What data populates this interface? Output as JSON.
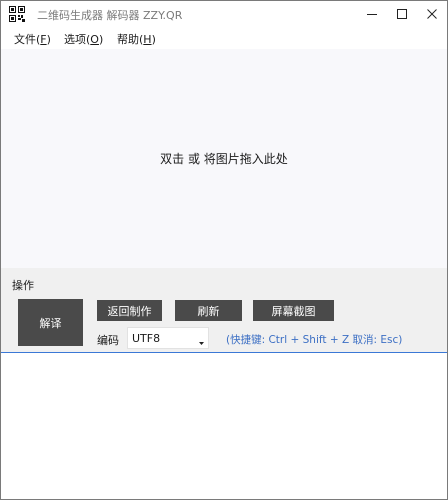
{
  "window": {
    "title": "二维码生成器 解码器 ZZY.QR"
  },
  "menu": {
    "file": {
      "label": "文件(",
      "acc": "F",
      "end": ")"
    },
    "options": {
      "label": "选项(",
      "acc": "O",
      "end": ")"
    },
    "help": {
      "label": "帮助(",
      "acc": "H",
      "end": ")"
    }
  },
  "drop_area": {
    "hint": "双击 或 将图片拖入此处"
  },
  "operations": {
    "section_label": "操作",
    "decode_label": "解译",
    "back_label": "返回制作",
    "refresh_label": "刷新",
    "screenshot_label": "屏幕截图",
    "encoding_label": "编码",
    "encoding_value": "UTF8",
    "shortcut_hint": "(快捷键: Ctrl + Shift + Z  取消: Esc)"
  },
  "colors": {
    "button_bg": "#4a4a4a",
    "hint_blue": "#3c6fc4",
    "focus_border": "#3a78d6"
  },
  "icons": {
    "app": "qr-code-icon",
    "minimize": "minimize-icon",
    "maximize": "maximize-icon",
    "close": "close-icon",
    "dropdown": "dropdown-arrow-icon"
  }
}
